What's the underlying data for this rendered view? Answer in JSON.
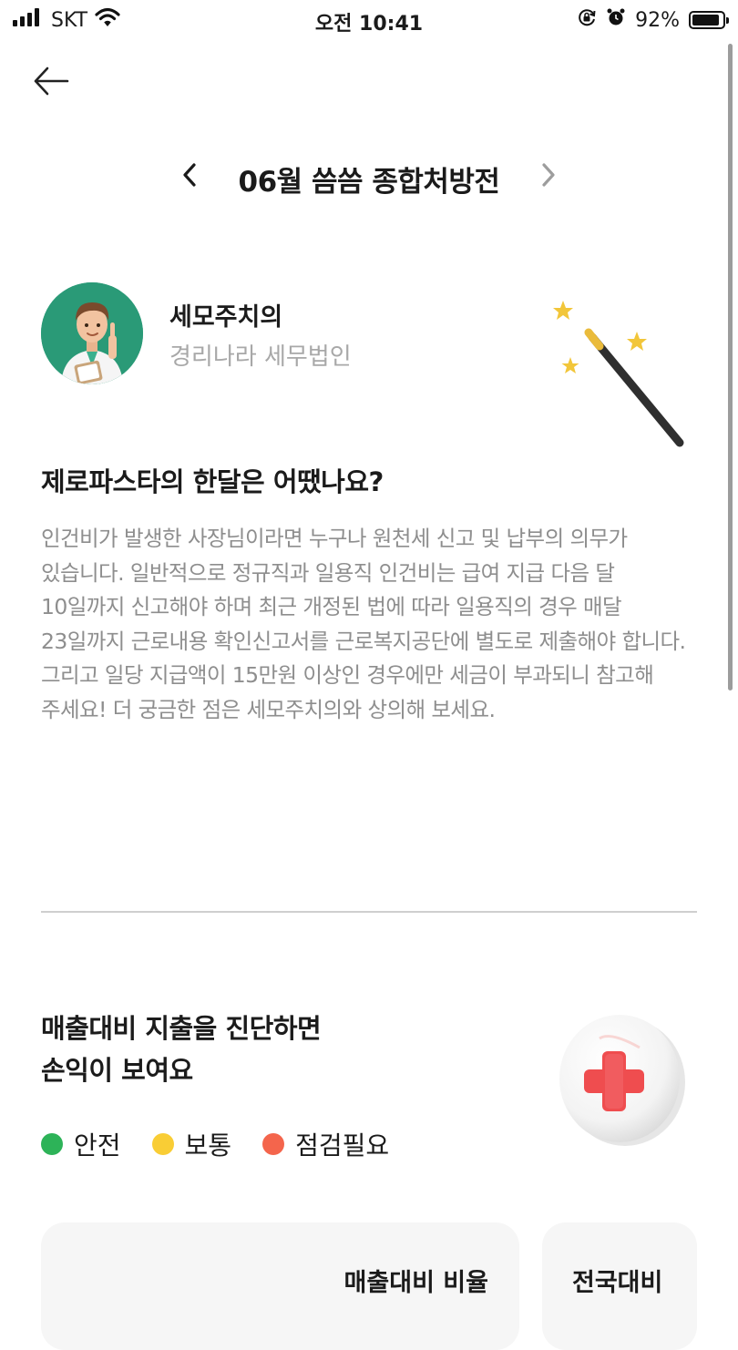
{
  "status_bar": {
    "carrier": "SKT",
    "time": "오전 10:41",
    "battery": "92%",
    "battery_level": 0.92
  },
  "nav": {
    "month_title": "06월 씀씀 종합처방전"
  },
  "advisor": {
    "name": "세모주치의",
    "organization": "경리나라 세무법인"
  },
  "summary": {
    "question": "제로파스타의 한달은 어땠나요?",
    "body": "인건비가 발생한 사장님이라면 누구나 원천세 신고 및 납부의 의무가 있습니다. 일반적으로 정규직과 일용직 인건비는 급여 지급 다음 달 10일까지 신고해야 하며 최근 개정된 법에 따라 일용직의 경우 매달 23일까지 근로내용 확인신고서를 근로복지공단에 별도로 제출해야 합니다. 그리고 일당 지급액이 15만원 이상인 경우에만 세금이 부과되니 참고해 주세요! 더 궁금한 점은 세모주치의와 상의해 보세요."
  },
  "diagnosis": {
    "title_line1": "매출대비 지출을 진단하면",
    "title_line2": "손익이 보여요",
    "legend": [
      {
        "label": "안전",
        "color": "#2db358"
      },
      {
        "label": "보통",
        "color": "#f9cd35"
      },
      {
        "label": "점검필요",
        "color": "#f4654c"
      }
    ]
  },
  "table": {
    "ratio_header": "매출대비 비율",
    "national_header": "전국대비"
  },
  "icons": [
    "signal-icon",
    "wifi-icon",
    "rotation-lock-icon",
    "alarm-icon",
    "battery-icon",
    "back-arrow-icon",
    "chevron-left-icon",
    "chevron-right-icon",
    "doctor-avatar-icon",
    "magic-wand-icon",
    "medical-cross-icon"
  ]
}
